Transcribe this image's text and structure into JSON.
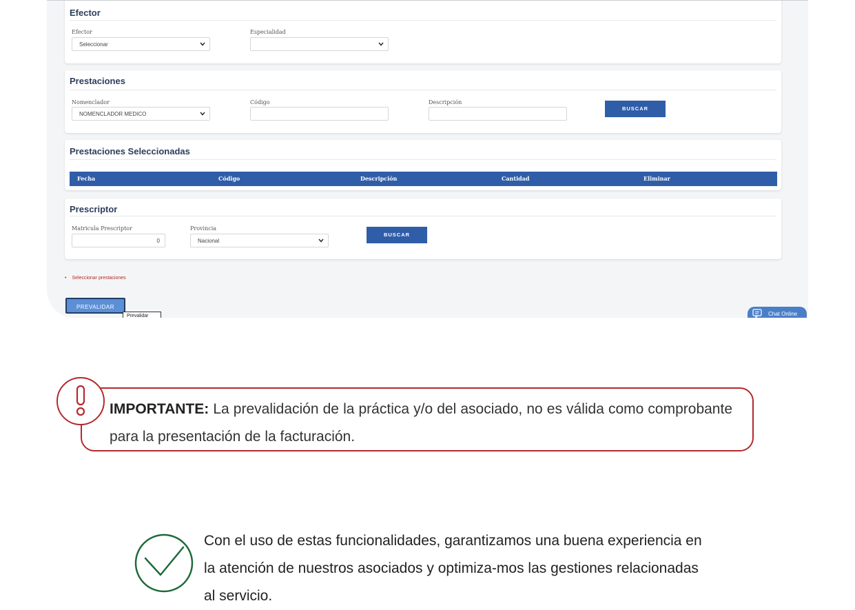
{
  "efector": {
    "title": "Efector",
    "efector_label": "Efector",
    "efector_value": "Seleccionar",
    "especialidad_label": "Especialidad",
    "especialidad_value": ""
  },
  "prestaciones": {
    "title": "Prestaciones",
    "nomenclador_label": "Nomenclador",
    "nomenclador_value": "NOMENCLADOR MEDICO",
    "codigo_label": "Código",
    "descripcion_label": "Descripción",
    "buscar_label": "BUSCAR"
  },
  "seleccionadas": {
    "title": "Prestaciones Seleccionadas",
    "columns": [
      "Fecha",
      "Código",
      "Descripción",
      "Cantidad",
      "Eliminar"
    ]
  },
  "prescriptor": {
    "title": "Prescriptor",
    "matricula_label": "Matricula Prescriptor",
    "matricula_value": "0",
    "provincia_label": "Provincia",
    "provincia_value": "Nacional",
    "buscar_label": "BUSCAR"
  },
  "validation_message": "Seleccionar prestaciones",
  "prevalidar_label": "PREVALIDAR",
  "tooltip_text": "Prevalidar",
  "chat_label": "Chat Online",
  "notice": {
    "strong": "IMPORTANTE:",
    "text": " La prevalidación de la práctica y/o del asociado, no es válida como comprobante para la presentación de la facturación."
  },
  "closing": {
    "text": "Con el uso de estas funcionalidades, garantizamos una buena experiencia en la atención de nuestros asociados y optimiza-mos las gestiones relacionadas al servicio."
  },
  "colors": {
    "accent_blue": "#2f5da8",
    "warning_red": "#b3282d",
    "success_green": "#1e6b3a"
  }
}
